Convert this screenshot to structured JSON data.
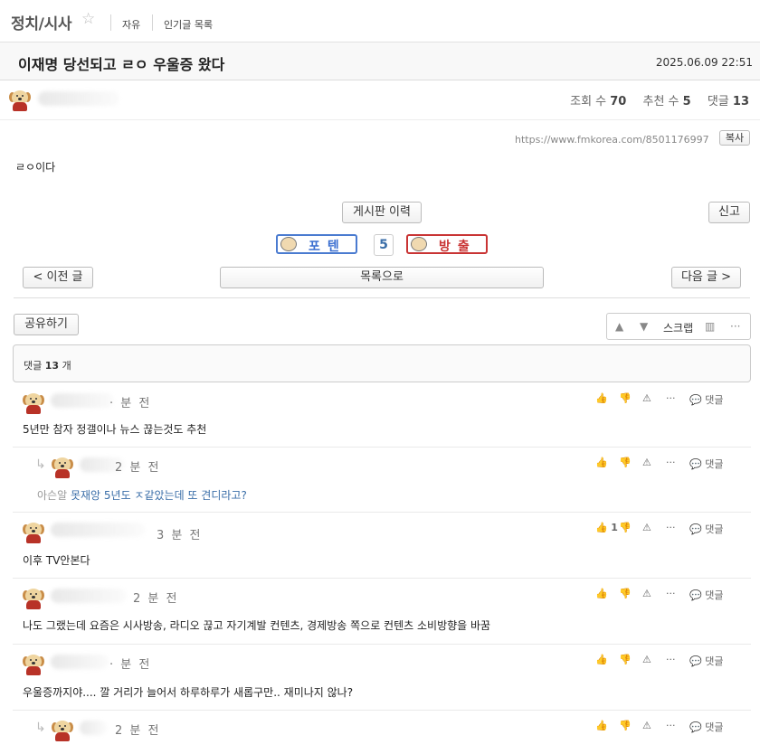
{
  "nav": {
    "board_title": "정치/시사",
    "star": "☆",
    "links": [
      "자유",
      "인기글 목록"
    ]
  },
  "post": {
    "title": "이재명 당선되고 ㄹㅇ 우울증 왔다",
    "date": "2025.06.09 22:51",
    "stats": {
      "views_label": "조회 수",
      "views": "70",
      "recommend_label": "추천 수",
      "recommend": "5",
      "comments_label": "댓글",
      "comments": "13"
    },
    "url": "https://www.fmkorea.com/8501176997",
    "copy_label": "복사",
    "body": "ㄹㅇ이다",
    "history_label": "게시판 이력",
    "report_label": "신고",
    "vote_up_label": "포텐",
    "vote_count": "5",
    "vote_down_label": "방출"
  },
  "pager": {
    "prev_label": "< 이전 글",
    "list_label": "목록으로",
    "next_label": "다음 글 >"
  },
  "tools": {
    "share_label": "공유하기",
    "scrap_label": "스크랩"
  },
  "comments_header": {
    "prefix": "댓글",
    "count": "13",
    "suffix": "개"
  },
  "comments": [
    {
      "time": "· 분 전",
      "text": "5년만 참자 정갤이나 뉴스 끊는것도 추천",
      "likes": "",
      "reply_label": "댓글"
    },
    {
      "time": "2 분 전",
      "reply_prefix": "아슨알",
      "text": "못재앙 5년도 ㅈ같았는데 또 견디라고?",
      "likes": "",
      "reply_label": "댓글"
    },
    {
      "time": "3 분 전",
      "text": "이후 TV안본다",
      "likes": "1",
      "reply_label": "댓글"
    },
    {
      "time": "2 분 전",
      "text": "나도 그랬는데 요즘은 시사방송, 라디오 끊고 자기계발 컨텐츠, 경제방송 쪽으로 컨텐츠 소비방향을 바꿈",
      "likes": "",
      "reply_label": "댓글"
    },
    {
      "time": "· 분 전",
      "text": "우울증까지야.... 깔 거리가 늘어서 하루하루가 새롭구만.. 재미나지 않나?",
      "likes": "",
      "reply_label": "댓글"
    },
    {
      "time": "2 분 전",
      "reply_prefix": "",
      "text": "",
      "likes": "",
      "reply_label": "댓글"
    }
  ]
}
